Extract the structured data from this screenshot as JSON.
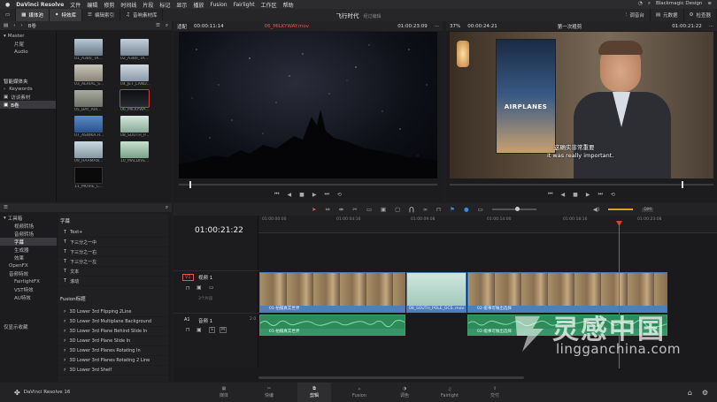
{
  "menubar": {
    "app": "DaVinci Resolve",
    "items": [
      "文件",
      "编辑",
      "修剪",
      "时间线",
      "片段",
      "标记",
      "显示",
      "播放",
      "Fusion",
      "Fairlight",
      "工作区",
      "帮助"
    ],
    "right": [
      "Blackmagic Design"
    ]
  },
  "toolbar": {
    "media_pool": "媒体池",
    "effects": "特效库",
    "edit_index": "编辑索引",
    "sound_library": "音响素材库",
    "project_title": "飞行时代",
    "project_sub": "经过编辑",
    "mixer": "调音台",
    "metadata": "元数据",
    "inspector": "检查器"
  },
  "mediapool": {
    "bin_label": "B卷",
    "tree": [
      "Master",
      "片尾",
      "Audio"
    ],
    "smart_bins_title": "智能媒体夹",
    "smart_bins": [
      "Keywords",
      "访谈素材",
      "B卷"
    ],
    "clips": [
      {
        "label": "01_A380_TA...",
        "color": "#7a8a96"
      },
      {
        "label": "02_A380_TA...",
        "color": "#8a9aa8"
      },
      {
        "label": "03_AERIAL_S...",
        "color": "#9a9488"
      },
      {
        "label": "04_JET_LAND...",
        "color": "#a0a8b4"
      },
      {
        "label": "05_BAY_AIR...",
        "color": "#8c9086"
      },
      {
        "label": "06_MILKYWA...",
        "color": "#14161c"
      },
      {
        "label": "07_ASWKA.H...",
        "color": "#4a74a8"
      },
      {
        "label": "08_SOUTH_P...",
        "color": "#a8c8b8"
      },
      {
        "label": "09_HAAMAN...",
        "color": "#aab8c0"
      },
      {
        "label": "10_MALDIVE...",
        "color": "#9ab8a4"
      },
      {
        "label": "11_MOVIE_C...",
        "color": "#101010"
      }
    ]
  },
  "source_viewer": {
    "zoom": "适配",
    "duration": "00:00:11:14",
    "clip_name": "06_MILKYWAY.mov",
    "timecode": "01:00:23:09"
  },
  "timeline_viewer": {
    "zoom": "37%",
    "duration": "00:00:24:21",
    "name": "第一次粗剪",
    "timecode": "01:00:21:22",
    "subtitle_cn": "这确实非常重要",
    "subtitle_en": "it was really important.",
    "poster_text": "AIRPLANES"
  },
  "effects": {
    "tree_title": "工具箱",
    "tree": [
      "视频转场",
      "音频转场",
      "字幕",
      "生成器",
      "效果",
      "OpenFX",
      "音频特效",
      "FairlightFX",
      "VST特效",
      "AU特效"
    ],
    "favorites": "仅显示收藏",
    "titles_header": "字幕",
    "titles": [
      "Text+",
      "下三分之一中",
      "下三分之一右",
      "下三分之一左",
      "文本",
      "滚动"
    ],
    "fusion_header": "Fusion标题",
    "fusion": [
      "3D Lower 3rd Flipping 2Line",
      "3D Lower 3rd Multiplane Background",
      "3D Lower 3rd Plane Behind Slide In",
      "3D Lower 3rd Plane Slide In",
      "3D Lower 3rd Planes Rotating In",
      "3D Lower 3rd Planes Rotating 2 Line",
      "3D Lower 3rd Shelf"
    ]
  },
  "timeline": {
    "timecode": "01:00:21:22",
    "ruler": [
      "01:00:00:00",
      "01:00:04:16",
      "01:00:09:08",
      "01:00:14:00",
      "01:00:18:16",
      "01:00:23:08"
    ],
    "video_track": {
      "id": "V1",
      "name": "视频 1",
      "count": "3个片段"
    },
    "audio_track": {
      "id": "A1",
      "name": "音频 1",
      "level": "2.0"
    },
    "video_clips": [
      "01-拍摄真实世界",
      "08_SOUTH_POLE_OCS..mov",
      "02-能事可做出选择"
    ],
    "audio_clips": [
      "01-拍摄真实世界",
      "02-能事可做出选择"
    ]
  },
  "bottombar": {
    "app_version": "DaVinci Resolve 16",
    "pages": [
      "媒体",
      "快编",
      "剪辑",
      "Fusion",
      "调色",
      "Fairlight",
      "交付"
    ]
  },
  "watermark": {
    "cn": "灵感中国",
    "url": "lingganchina.com"
  }
}
